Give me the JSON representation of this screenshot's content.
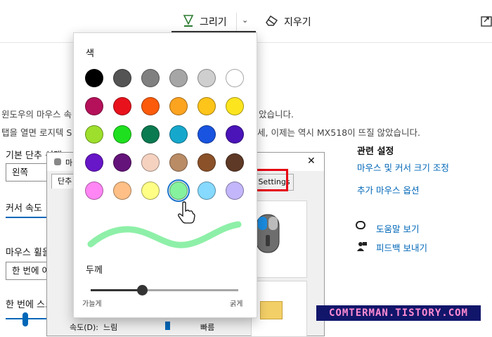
{
  "toolbar": {
    "draw_label": "그리기",
    "erase_label": "지우기"
  },
  "background": {
    "line1": "윈도우의 마우스 속",
    "line1_end": "았습니다.",
    "line2": "탭을 열면 로지텍 S",
    "line2_end": "세, 이제는 역시 MX518이 뜨질 않았습니다.",
    "primary_button_label": "기본 단추 선택",
    "primary_button_value": "왼쪽",
    "cursor_speed_label": "커서 속도",
    "wheel_label": "마우스 휠을",
    "wheel_value": "한 번에 여",
    "scroll_label": "한 번에 스크",
    "related_title": "관련 설정",
    "related_link1": "마우스 및 커서 크기 조정",
    "related_link2": "추가 마우스 옵션",
    "help_link": "도움말 보기",
    "feedback_link": "피드백 보내기",
    "dialog_title": "마",
    "dialog_tab": "단추",
    "settings_tab": "Settings",
    "dialog_speed_label": "속도(D):",
    "dialog_slow": "느림",
    "dialog_fast": "빠름"
  },
  "popup": {
    "color_title": "색",
    "thickness_title": "두께",
    "thin_label": "가늘게",
    "thick_label": "굵게",
    "thickness_value": 0.35,
    "stroke_color": "#8ef0a8",
    "colors": [
      "#000000",
      "#545454",
      "#808080",
      "#a6a6a6",
      "#cfcfcf",
      "#ffffff",
      "#b5115a",
      "#e8121c",
      "#fb5b0a",
      "#fca320",
      "#fdc41a",
      "#fce51f",
      "#9ddf2c",
      "#1fe01f",
      "#0a7a51",
      "#16a8cc",
      "#1954e0",
      "#4a14b8",
      "#6716c8",
      "#64137a",
      "#f5d2c0",
      "#b98c66",
      "#8b5129",
      "#5e3925",
      "#ff86f4",
      "#ffbf86",
      "#ffff86",
      "#86f29e",
      "#86d9ff",
      "#c3b6fa"
    ],
    "selected_index": 27
  },
  "watermark": "COMTERMAN.TISTORY.COM"
}
